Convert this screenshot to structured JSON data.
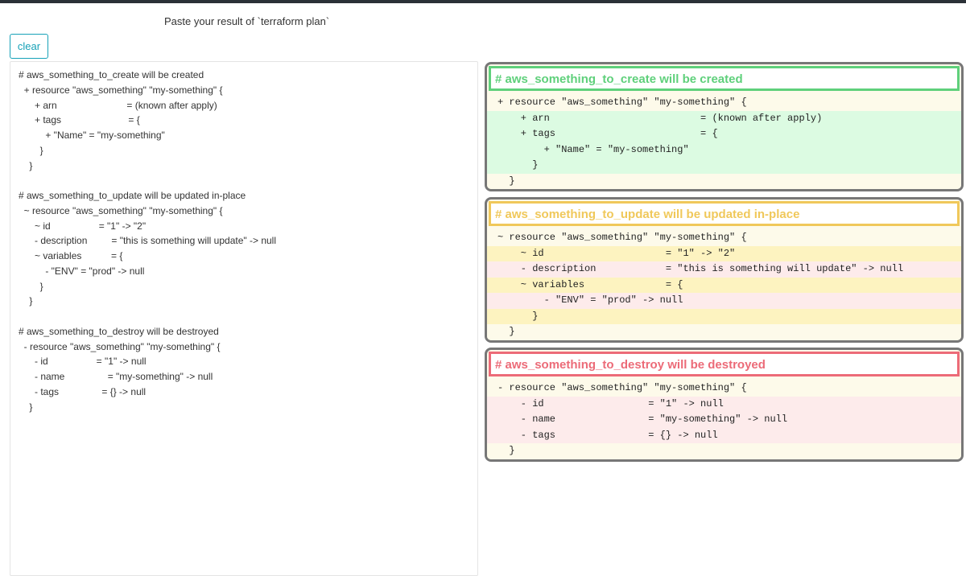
{
  "header": {
    "instruction": "Paste your result of `terraform plan`"
  },
  "toolbar": {
    "clear_label": "clear"
  },
  "input": {
    "value": "# aws_something_to_create will be created\n  + resource \"aws_something\" \"my-something\" {\n      + arn                          = (known after apply)\n      + tags                         = {\n          + \"Name\" = \"my-something\"\n        }\n    }\n\n# aws_something_to_update will be updated in-place\n  ~ resource \"aws_something\" \"my-something\" {\n      ~ id                  = \"1\" -> \"2\"\n      - description         = \"this is something will update\" -> null\n      ~ variables           = {\n          - \"ENV\" = \"prod\" -> null\n        }\n    }\n\n# aws_something_to_destroy will be destroyed\n  - resource \"aws_something\" \"my-something\" {\n      - id                  = \"1\" -> null\n      - name                = \"my-something\" -> null\n      - tags                = {} -> null\n    }"
  },
  "results": [
    {
      "kind": "create",
      "title": "# aws_something_to_create will be created",
      "lines": [
        {
          "text": "+ resource \"aws_something\" \"my-something\" {",
          "tone": "neutral"
        },
        {
          "text": "    + arn                          = (known after apply)",
          "tone": "green"
        },
        {
          "text": "    + tags                         = {",
          "tone": "green"
        },
        {
          "text": "        + \"Name\" = \"my-something\"",
          "tone": "green"
        },
        {
          "text": "      }",
          "tone": "green"
        },
        {
          "text": "  }",
          "tone": "neutral"
        }
      ]
    },
    {
      "kind": "update",
      "title": "# aws_something_to_update will be updated in-place",
      "lines": [
        {
          "text": "~ resource \"aws_something\" \"my-something\" {",
          "tone": "neutral"
        },
        {
          "text": "    ~ id                     = \"1\" -> \"2\"",
          "tone": "yellow"
        },
        {
          "text": "    - description            = \"this is something will update\" -> null",
          "tone": "red"
        },
        {
          "text": "    ~ variables              = {",
          "tone": "yellow"
        },
        {
          "text": "        - \"ENV\" = \"prod\" -> null",
          "tone": "red"
        },
        {
          "text": "      }",
          "tone": "yellow"
        },
        {
          "text": "  }",
          "tone": "neutral"
        }
      ]
    },
    {
      "kind": "destroy",
      "title": "# aws_something_to_destroy will be destroyed",
      "lines": [
        {
          "text": "- resource \"aws_something\" \"my-something\" {",
          "tone": "neutral"
        },
        {
          "text": "    - id                  = \"1\" -> null",
          "tone": "red"
        },
        {
          "text": "    - name                = \"my-something\" -> null",
          "tone": "red"
        },
        {
          "text": "    - tags                = {} -> null",
          "tone": "red"
        },
        {
          "text": "  }",
          "tone": "neutral"
        }
      ]
    }
  ],
  "colors": {
    "create": "#5fd07b",
    "update": "#f0c85a",
    "destroy": "#ec6b78",
    "line_added": "#dcfbe2",
    "line_changed": "#fdf3c0",
    "line_removed": "#fdebeb",
    "line_neutral": "#fdfaea",
    "accent": "#17a2b8"
  }
}
